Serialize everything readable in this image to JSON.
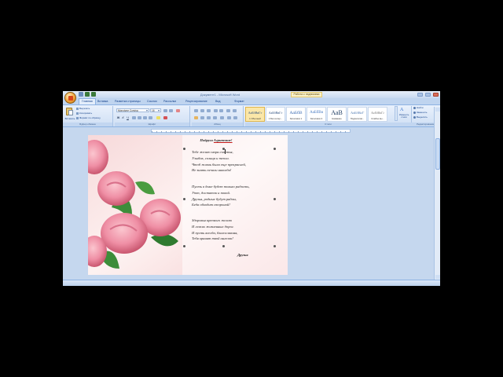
{
  "window": {
    "title": "Документ1 - Microsoft Word",
    "context_tab_title": "Работа с надписями"
  },
  "ribbon": {
    "tabs": [
      {
        "label": "Главная",
        "active": true
      },
      {
        "label": "Вставка"
      },
      {
        "label": "Разметка страницы"
      },
      {
        "label": "Ссылки"
      },
      {
        "label": "Рассылки"
      },
      {
        "label": "Рецензирование"
      },
      {
        "label": "Вид"
      },
      {
        "label": "Формат"
      }
    ],
    "clipboard": {
      "paste_label": "Вставить",
      "cut_label": "Вырезать",
      "copy_label": "Копировать",
      "format_painter_label": "Формат по образцу",
      "caption": "Буфер обмена"
    },
    "font": {
      "font_name": "Monotype Corsiva",
      "font_size": "16",
      "caption": "Шрифт",
      "bold": "Ж",
      "italic": "К",
      "underline": "Ч"
    },
    "paragraph": {
      "caption": "Абзац"
    },
    "styles": {
      "caption": "Стили",
      "items": [
        {
          "sample": "АаБбВвГг",
          "name": "1 Обычный",
          "selected": true
        },
        {
          "sample": "АаБбВвГг",
          "name": "1 Без интер..."
        },
        {
          "sample": "АаБбВ",
          "name": "Заголовок 1"
        },
        {
          "sample": "АаБбВв",
          "name": "Заголовок 2"
        },
        {
          "sample": "АаВ",
          "name": "Название"
        },
        {
          "sample": "АаБбВвГ",
          "name": "Подзаголов..."
        },
        {
          "sample": "АаБбВвГг",
          "name": "Слабое вы..."
        }
      ],
      "change_styles_label": "Изменить стили"
    },
    "editing": {
      "find_label": "Найти",
      "replace_label": "Заменить",
      "select_label": "Выделить",
      "caption": "Редактирование"
    }
  },
  "document": {
    "title_prefix": "Подруга ",
    "title_name": "Агриппине!",
    "stanzas": [
      [
        "Тебе желаю моря счастья,",
        "Улыбок, солнца и тепла.",
        "Чтоб жизнь была еще прекрасней,",
        "Не знать печали никогда!"
      ],
      [
        "Пусть в доме будет только радость,",
        "Уют, достаток и покой.",
        "Друзья, родные будут рядом,",
        "Беда обходит стороной!"
      ],
      [
        "Здоровья крепкого желаю",
        "И легких жизненных дорог.",
        "И пусть всегда, благославляя,",
        "Тебя хранит твой ангелок!"
      ]
    ],
    "signature": "Друзья"
  },
  "colors": {
    "ribbon_accent": "#15428b",
    "window_bg": "#c5d7ee",
    "rose": "#ef8fa5",
    "leaf": "#3d8d3a"
  }
}
